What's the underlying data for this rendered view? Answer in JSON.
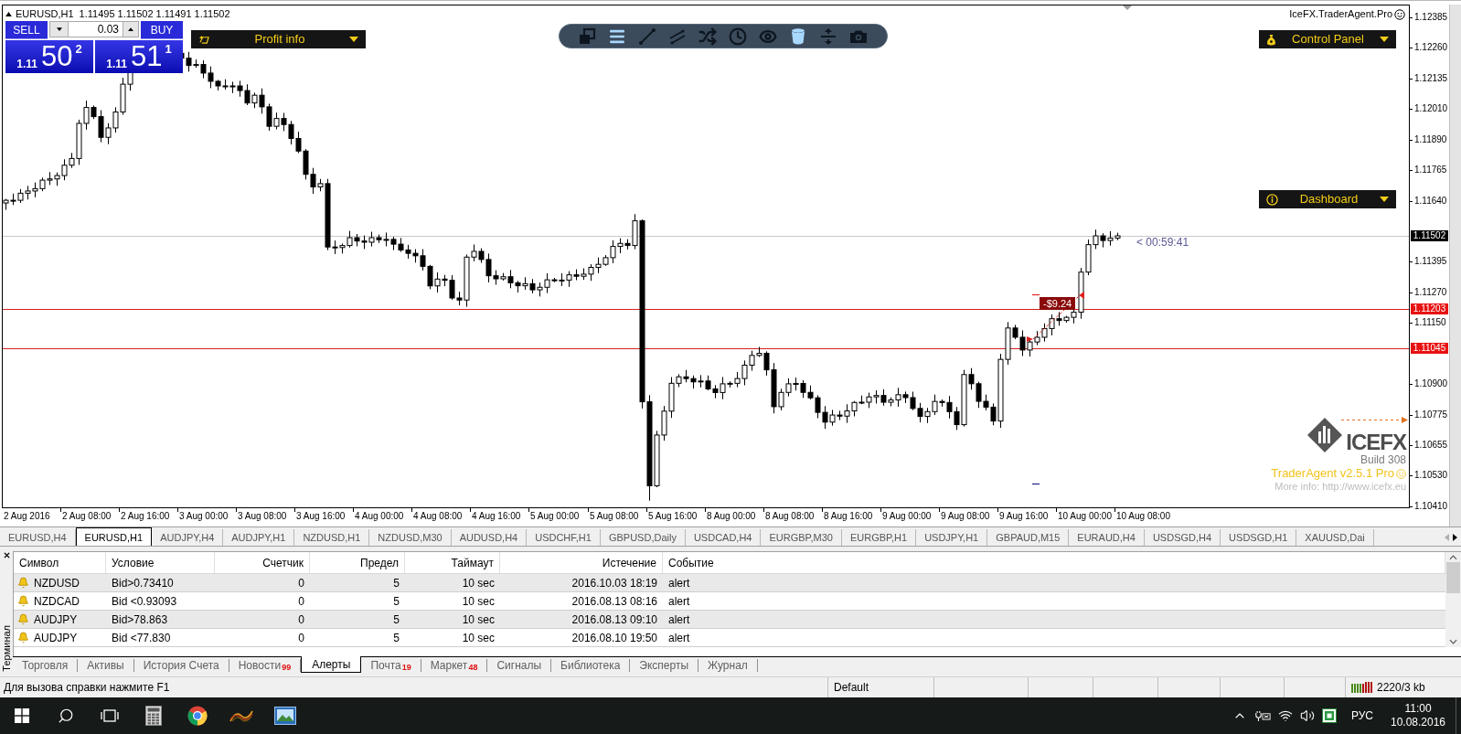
{
  "chart": {
    "symbol": "EURUSD,H1",
    "quotes": "1.11495 1.11502 1.11491 1.11502",
    "trade_panel": {
      "sell": "SELL",
      "buy": "BUY",
      "lot": "0.03",
      "sell_price": {
        "prefix": "1.11",
        "pips": "50",
        "fraction": "2"
      },
      "buy_price": {
        "prefix": "1.11",
        "pips": "51",
        "fraction": "1"
      }
    },
    "profit_info": {
      "label": "Profit info"
    },
    "toolbar": [
      {
        "kind": "windows",
        "active": false
      },
      {
        "kind": "menu",
        "active": true
      },
      {
        "kind": "line",
        "active": false
      },
      {
        "kind": "channel",
        "active": false
      },
      {
        "kind": "shuffle",
        "active": false
      },
      {
        "kind": "clock",
        "active": false
      },
      {
        "kind": "eye",
        "active": false
      },
      {
        "kind": "cup",
        "active": true
      },
      {
        "kind": "split",
        "active": false
      },
      {
        "kind": "camera",
        "active": false
      }
    ],
    "ea_label": "IceFX.TraderAgent.Pro",
    "panels": [
      {
        "kind": "control",
        "label": "Control Panel"
      },
      {
        "kind": "info",
        "label": "Dashboard"
      }
    ],
    "countdown": "< 00:59:41",
    "position_label": "-$9.24",
    "logo": {
      "name": "ICEFX",
      "build": "Build 308",
      "product": "TraderAgent v2.5.1 Pro",
      "info": "More info: http://www.icefx.eu"
    },
    "price_ticks": [
      "1.12385",
      "1.12260",
      "1.12135",
      "1.12010",
      "1.11890",
      "1.11765",
      "1.11640",
      "1.11395",
      "1.11270",
      "1.11150",
      "1.10900",
      "1.10775",
      "1.10655",
      "1.10530",
      "1.10410"
    ],
    "price_markers": [
      {
        "kind": "bid",
        "label": "1.11502"
      },
      {
        "kind": "level",
        "label": "1.11203"
      },
      {
        "kind": "level",
        "label": "1.11045"
      }
    ],
    "time_labels": [
      "2 Aug 2016",
      "2 Aug 08:00",
      "2 Aug 16:00",
      "3 Aug 00:00",
      "3 Aug 08:00",
      "3 Aug 16:00",
      "4 Aug 00:00",
      "4 Aug 08:00",
      "4 Aug 16:00",
      "5 Aug 00:00",
      "5 Aug 08:00",
      "5 Aug 16:00",
      "8 Aug 00:00",
      "8 Aug 08:00",
      "8 Aug 16:00",
      "9 Aug 00:00",
      "9 Aug 08:00",
      "9 Aug 16:00",
      "10 Aug 00:00",
      "10 Aug 08:00"
    ]
  },
  "symbol_tabs": [
    {
      "label": "EURUSD,H4",
      "selected": false
    },
    {
      "label": "EURUSD,H1",
      "selected": true
    },
    {
      "label": "AUDJPY,H4",
      "selected": false
    },
    {
      "label": "AUDJPY,H1",
      "selected": false
    },
    {
      "label": "NZDUSD,H1",
      "selected": false
    },
    {
      "label": "NZDUSD,M30",
      "selected": false
    },
    {
      "label": "AUDUSD,H4",
      "selected": false
    },
    {
      "label": "USDCHF,H1",
      "selected": false
    },
    {
      "label": "GBPUSD,Daily",
      "selected": false
    },
    {
      "label": "USDCAD,H4",
      "selected": false
    },
    {
      "label": "EURGBP,M30",
      "selected": false
    },
    {
      "label": "EURGBP,H1",
      "selected": false
    },
    {
      "label": "USDJPY,H1",
      "selected": false
    },
    {
      "label": "GBPAUD,M15",
      "selected": false
    },
    {
      "label": "EURAUD,H4",
      "selected": false
    },
    {
      "label": "USDSGD,H4",
      "selected": false
    },
    {
      "label": "USDSGD,H1",
      "selected": false
    },
    {
      "label": "XAUUSD,Dai",
      "selected": false
    }
  ],
  "terminal": {
    "title": "Терминал",
    "columns": [
      "Символ",
      "Условие",
      "Счетчик",
      "Предел",
      "Таймаут",
      "Истечение",
      "Событие"
    ],
    "rows": [
      {
        "symbol": "NZDUSD",
        "condition": "Bid>0.73410",
        "counter": "0",
        "limit": "5",
        "timeout": "10 sec",
        "expiry": "2016.10.03 18:19",
        "event": "alert"
      },
      {
        "symbol": "NZDCAD",
        "condition": "Bid <0.93093",
        "counter": "0",
        "limit": "5",
        "timeout": "10 sec",
        "expiry": "2016.08.13 08:16",
        "event": "alert"
      },
      {
        "symbol": "AUDJPY",
        "condition": "Bid>78.863",
        "counter": "0",
        "limit": "5",
        "timeout": "10 sec",
        "expiry": "2016.08.13 09:10",
        "event": "alert"
      },
      {
        "symbol": "AUDJPY",
        "condition": "Bid <77.830",
        "counter": "0",
        "limit": "5",
        "timeout": "10 sec",
        "expiry": "2016.08.10 19:50",
        "event": "alert"
      }
    ],
    "tabs": [
      {
        "label": "Торговля",
        "selected": false
      },
      {
        "label": "Активы",
        "selected": false
      },
      {
        "label": "История Счета",
        "selected": false
      },
      {
        "label": "Новости",
        "badge": "99",
        "selected": false
      },
      {
        "label": "Алерты",
        "selected": true
      },
      {
        "label": "Почта",
        "badge": "19",
        "selected": false
      },
      {
        "label": "Маркет",
        "badge": "48",
        "selected": false
      },
      {
        "label": "Сигналы",
        "selected": false
      },
      {
        "label": "Библиотека",
        "selected": false
      },
      {
        "label": "Эксперты",
        "selected": false
      },
      {
        "label": "Журнал",
        "selected": false
      }
    ]
  },
  "status_bar": {
    "help": "Для вызова справки нажмите F1",
    "profile": "Default",
    "traffic": "2220/3 kb"
  },
  "taskbar": {
    "language": "РУС",
    "time": "11:00",
    "date": "10.08.2016"
  }
}
